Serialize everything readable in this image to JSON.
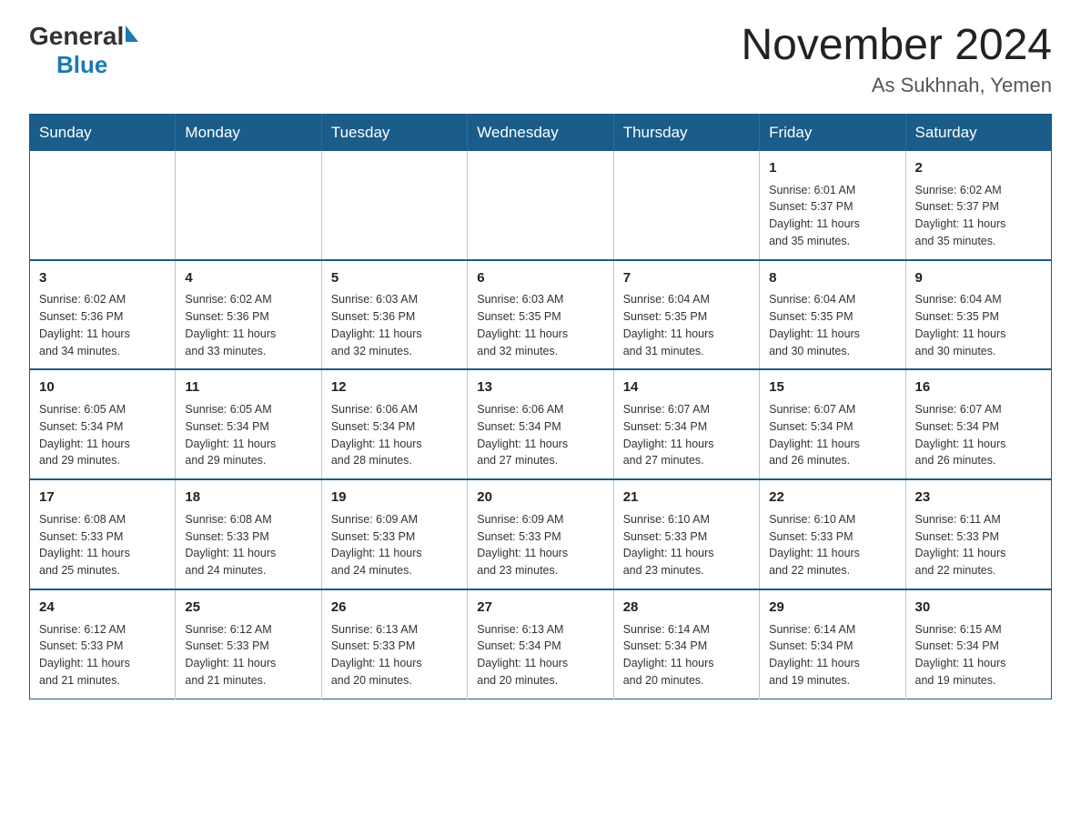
{
  "header": {
    "title": "November 2024",
    "subtitle": "As Sukhnah, Yemen",
    "logo_general": "General",
    "logo_blue": "Blue"
  },
  "weekdays": [
    "Sunday",
    "Monday",
    "Tuesday",
    "Wednesday",
    "Thursday",
    "Friday",
    "Saturday"
  ],
  "weeks": [
    [
      {
        "day": "",
        "info": ""
      },
      {
        "day": "",
        "info": ""
      },
      {
        "day": "",
        "info": ""
      },
      {
        "day": "",
        "info": ""
      },
      {
        "day": "",
        "info": ""
      },
      {
        "day": "1",
        "info": "Sunrise: 6:01 AM\nSunset: 5:37 PM\nDaylight: 11 hours\nand 35 minutes."
      },
      {
        "day": "2",
        "info": "Sunrise: 6:02 AM\nSunset: 5:37 PM\nDaylight: 11 hours\nand 35 minutes."
      }
    ],
    [
      {
        "day": "3",
        "info": "Sunrise: 6:02 AM\nSunset: 5:36 PM\nDaylight: 11 hours\nand 34 minutes."
      },
      {
        "day": "4",
        "info": "Sunrise: 6:02 AM\nSunset: 5:36 PM\nDaylight: 11 hours\nand 33 minutes."
      },
      {
        "day": "5",
        "info": "Sunrise: 6:03 AM\nSunset: 5:36 PM\nDaylight: 11 hours\nand 32 minutes."
      },
      {
        "day": "6",
        "info": "Sunrise: 6:03 AM\nSunset: 5:35 PM\nDaylight: 11 hours\nand 32 minutes."
      },
      {
        "day": "7",
        "info": "Sunrise: 6:04 AM\nSunset: 5:35 PM\nDaylight: 11 hours\nand 31 minutes."
      },
      {
        "day": "8",
        "info": "Sunrise: 6:04 AM\nSunset: 5:35 PM\nDaylight: 11 hours\nand 30 minutes."
      },
      {
        "day": "9",
        "info": "Sunrise: 6:04 AM\nSunset: 5:35 PM\nDaylight: 11 hours\nand 30 minutes."
      }
    ],
    [
      {
        "day": "10",
        "info": "Sunrise: 6:05 AM\nSunset: 5:34 PM\nDaylight: 11 hours\nand 29 minutes."
      },
      {
        "day": "11",
        "info": "Sunrise: 6:05 AM\nSunset: 5:34 PM\nDaylight: 11 hours\nand 29 minutes."
      },
      {
        "day": "12",
        "info": "Sunrise: 6:06 AM\nSunset: 5:34 PM\nDaylight: 11 hours\nand 28 minutes."
      },
      {
        "day": "13",
        "info": "Sunrise: 6:06 AM\nSunset: 5:34 PM\nDaylight: 11 hours\nand 27 minutes."
      },
      {
        "day": "14",
        "info": "Sunrise: 6:07 AM\nSunset: 5:34 PM\nDaylight: 11 hours\nand 27 minutes."
      },
      {
        "day": "15",
        "info": "Sunrise: 6:07 AM\nSunset: 5:34 PM\nDaylight: 11 hours\nand 26 minutes."
      },
      {
        "day": "16",
        "info": "Sunrise: 6:07 AM\nSunset: 5:34 PM\nDaylight: 11 hours\nand 26 minutes."
      }
    ],
    [
      {
        "day": "17",
        "info": "Sunrise: 6:08 AM\nSunset: 5:33 PM\nDaylight: 11 hours\nand 25 minutes."
      },
      {
        "day": "18",
        "info": "Sunrise: 6:08 AM\nSunset: 5:33 PM\nDaylight: 11 hours\nand 24 minutes."
      },
      {
        "day": "19",
        "info": "Sunrise: 6:09 AM\nSunset: 5:33 PM\nDaylight: 11 hours\nand 24 minutes."
      },
      {
        "day": "20",
        "info": "Sunrise: 6:09 AM\nSunset: 5:33 PM\nDaylight: 11 hours\nand 23 minutes."
      },
      {
        "day": "21",
        "info": "Sunrise: 6:10 AM\nSunset: 5:33 PM\nDaylight: 11 hours\nand 23 minutes."
      },
      {
        "day": "22",
        "info": "Sunrise: 6:10 AM\nSunset: 5:33 PM\nDaylight: 11 hours\nand 22 minutes."
      },
      {
        "day": "23",
        "info": "Sunrise: 6:11 AM\nSunset: 5:33 PM\nDaylight: 11 hours\nand 22 minutes."
      }
    ],
    [
      {
        "day": "24",
        "info": "Sunrise: 6:12 AM\nSunset: 5:33 PM\nDaylight: 11 hours\nand 21 minutes."
      },
      {
        "day": "25",
        "info": "Sunrise: 6:12 AM\nSunset: 5:33 PM\nDaylight: 11 hours\nand 21 minutes."
      },
      {
        "day": "26",
        "info": "Sunrise: 6:13 AM\nSunset: 5:33 PM\nDaylight: 11 hours\nand 20 minutes."
      },
      {
        "day": "27",
        "info": "Sunrise: 6:13 AM\nSunset: 5:34 PM\nDaylight: 11 hours\nand 20 minutes."
      },
      {
        "day": "28",
        "info": "Sunrise: 6:14 AM\nSunset: 5:34 PM\nDaylight: 11 hours\nand 20 minutes."
      },
      {
        "day": "29",
        "info": "Sunrise: 6:14 AM\nSunset: 5:34 PM\nDaylight: 11 hours\nand 19 minutes."
      },
      {
        "day": "30",
        "info": "Sunrise: 6:15 AM\nSunset: 5:34 PM\nDaylight: 11 hours\nand 19 minutes."
      }
    ]
  ]
}
